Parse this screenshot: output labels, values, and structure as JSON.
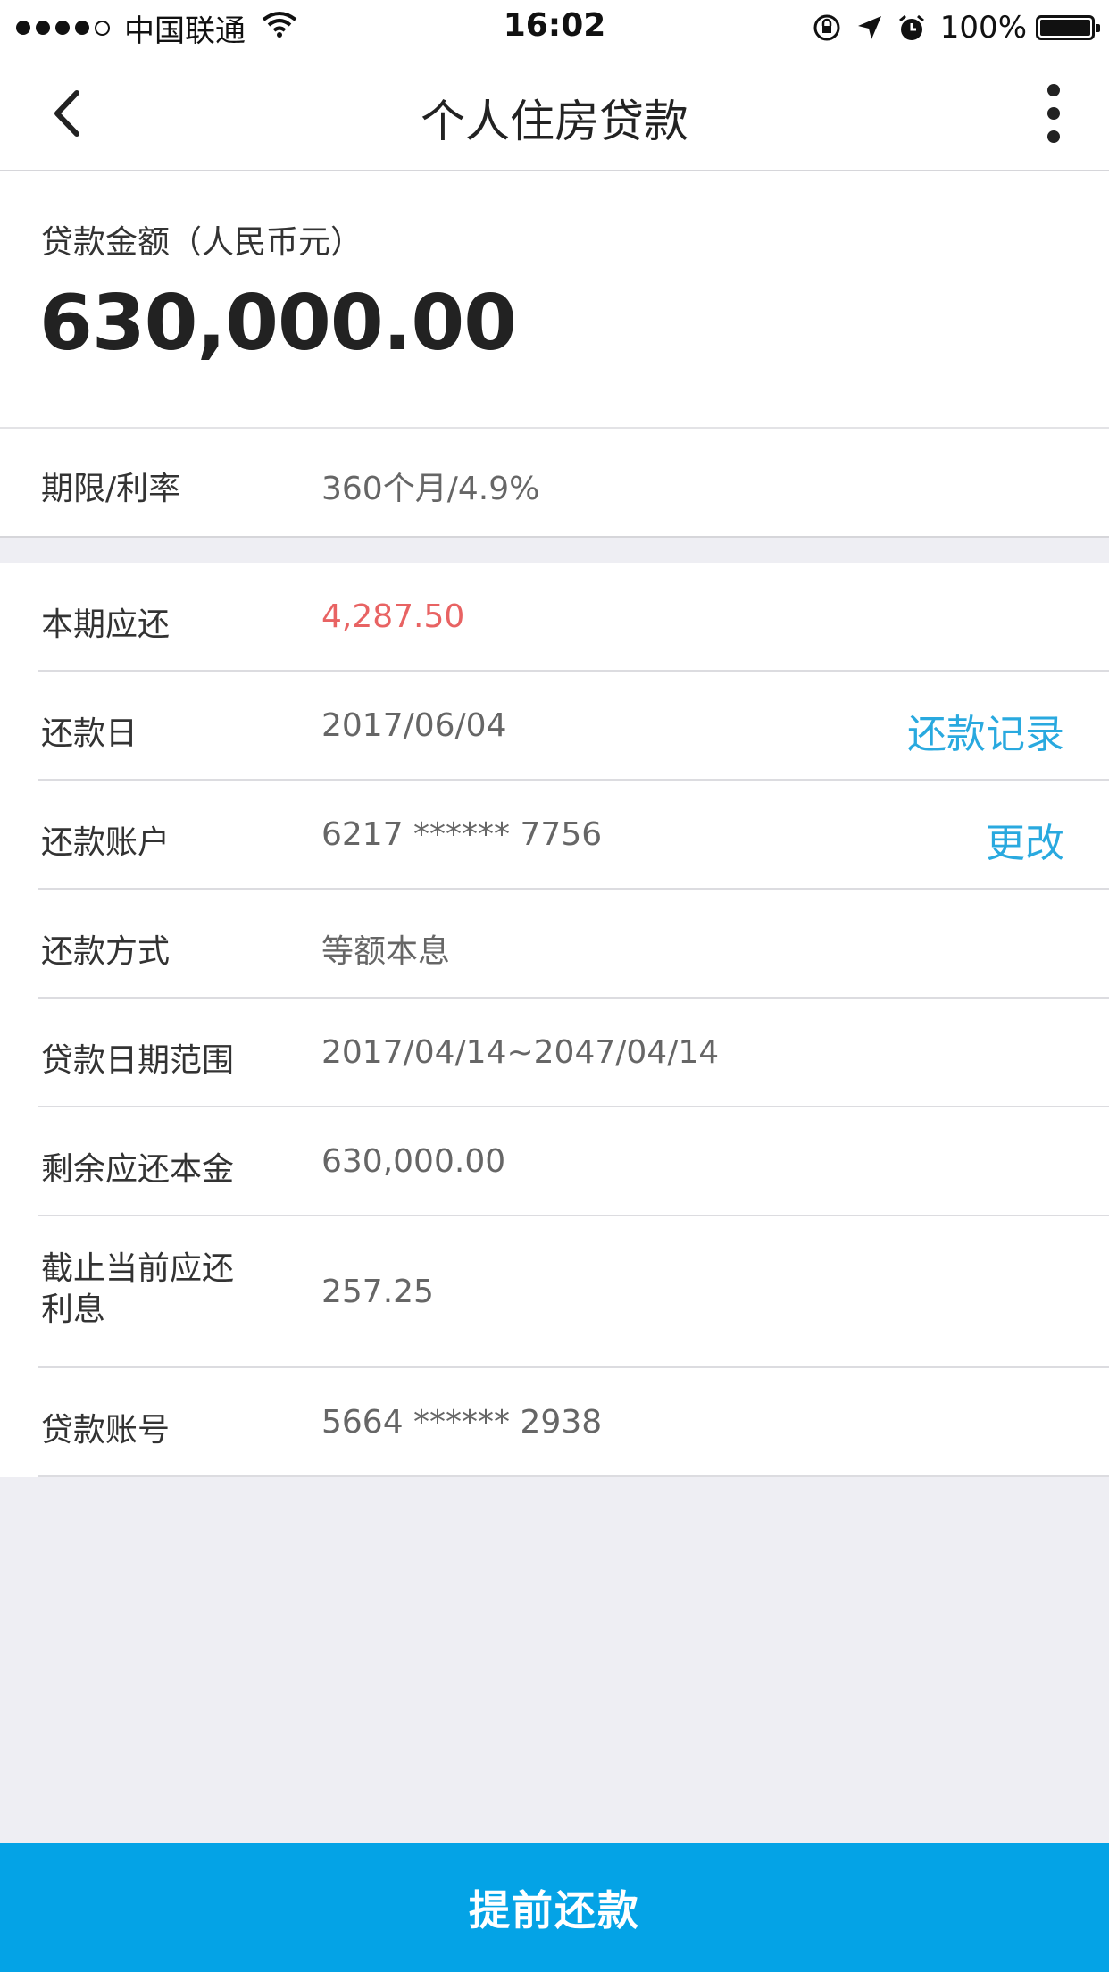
{
  "status_bar": {
    "carrier": "中国联通",
    "time": "16:02",
    "battery": "100%"
  },
  "nav": {
    "title": "个人住房贷款"
  },
  "amount": {
    "label": "贷款金额（人民币元）",
    "value": "630,000.00"
  },
  "term_row": {
    "label": "期限/利率",
    "value": "360个月/4.9%"
  },
  "details": [
    {
      "label": "本期应还",
      "value": "4,287.50"
    },
    {
      "label": "还款日",
      "value": "2017/06/04",
      "action": "还款记录"
    },
    {
      "label": "还款账户",
      "value": "6217 ****** 7756",
      "action": "更改"
    },
    {
      "label": "还款方式",
      "value": "等额本息"
    },
    {
      "label": "贷款日期范围",
      "value": "2017/04/14~2047/04/14"
    },
    {
      "label": "剩余应还本金",
      "value": "630,000.00"
    },
    {
      "label_line1": "截止当前应还",
      "label_line2": "利息",
      "value": "257.25"
    },
    {
      "label": "贷款账号",
      "value": "5664 ****** 2938"
    }
  ],
  "footer": {
    "button_label": "提前还款"
  },
  "colors": {
    "accent": "#04a3e6",
    "link": "#29a9df",
    "due_amount": "#e86363"
  },
  "icons": {
    "back": "chevron-left-icon",
    "more": "more-vertical-icon",
    "wifi": "wifi-icon",
    "rotation_lock": "rotation-lock-icon",
    "location": "location-arrow-icon",
    "alarm": "alarm-icon",
    "battery": "battery-icon"
  }
}
